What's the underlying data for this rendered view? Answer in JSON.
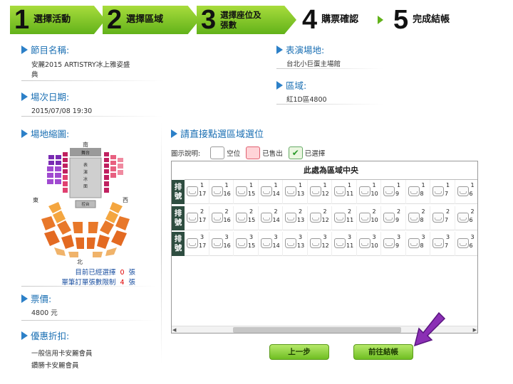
{
  "steps": [
    {
      "num": "1",
      "label": "選擇活動"
    },
    {
      "num": "2",
      "label": "選擇區域"
    },
    {
      "num": "3",
      "label_line1": "選擇座位及",
      "label_line2": "張數"
    },
    {
      "num": "4",
      "label": "購票確認"
    },
    {
      "num": "5",
      "label": "完成結帳"
    }
  ],
  "program": {
    "title": "節目名稱:",
    "value_line1": "安麗2015 ARTISTRY冰上雅姿盛",
    "value_line2": "典"
  },
  "venue_info": {
    "title": "表演場地:",
    "value": "台北小巨蛋主場館"
  },
  "session": {
    "title": "場次日期:",
    "value": "2015/07/08 19:30"
  },
  "zone": {
    "title": "區域:",
    "value": "紅1D區4800"
  },
  "venue_map": {
    "title": "場地縮圖:",
    "north": "南",
    "south": "北",
    "east": "東",
    "west": "西",
    "stage": "舞台",
    "rink1": "表",
    "rink2": "演",
    "rink3": "冰",
    "rink4": "面",
    "control": "控台"
  },
  "selection": {
    "selected_label": "目前已經選擇",
    "selected_count": "0",
    "selected_unit": "張",
    "limit_label": "單筆訂單張數限制",
    "limit_count": "4",
    "limit_unit": "張"
  },
  "price": {
    "title": "票價:",
    "value": "4800 元"
  },
  "discount": {
    "title": "優惠折扣:",
    "line1": "一般信用卡安麗會員",
    "line2": "鑽勝卡安麗會員"
  },
  "seat_picker": {
    "title": "請直接點選區域選位",
    "legend_label": "圖示說明:",
    "legend_empty": "空位",
    "legend_sold": "已售出",
    "legend_selected": "已選擇",
    "center_text": "此處為區域中央",
    "row_label": "排號",
    "rows": [
      {
        "row": "1",
        "seats": [
          "17",
          "16",
          "15",
          "14",
          "13",
          "12",
          "11",
          "10",
          "9",
          "8",
          "7",
          "6"
        ]
      },
      {
        "row": "2",
        "seats": [
          "17",
          "16",
          "15",
          "14",
          "13",
          "12",
          "11",
          "10",
          "9",
          "8",
          "7",
          "6"
        ]
      },
      {
        "row": "3",
        "seats": [
          "17",
          "16",
          "15",
          "14",
          "13",
          "12",
          "11",
          "10",
          "9",
          "8",
          "7",
          "6"
        ]
      }
    ]
  },
  "buttons": {
    "prev": "上一步",
    "next": "前往結帳"
  },
  "colors": {
    "accent_green": "#6fbf22",
    "heading_blue": "#1a6fb3",
    "sold_red": "#e00000",
    "row_label_bg": "#2e4d40"
  }
}
